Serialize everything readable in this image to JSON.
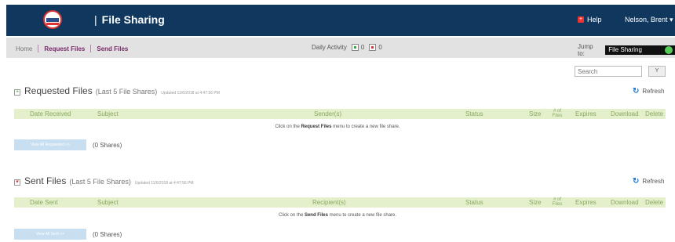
{
  "header": {
    "app_title": "File Sharing",
    "separator": "|",
    "help_label": "Help",
    "help_icon": "+",
    "user_name": "Nelson, Brent",
    "user_caret": "▾"
  },
  "nav": {
    "home": "Home",
    "request_files": "Request Files",
    "send_files": "Send Files"
  },
  "daily_activity": {
    "label": "Daily Activity",
    "up_count": "0",
    "down_count": "0"
  },
  "jump": {
    "label": "Jump to:",
    "selected": "File Sharing"
  },
  "search": {
    "placeholder": "Search",
    "button": "Y"
  },
  "requested": {
    "title": "Requested Files",
    "subtitle": "(Last 5 File Shares)",
    "updated": "Updated 11/6/2018 at 4:47:56 PM",
    "refresh_label": "Refresh",
    "columns": {
      "date": "Date Received",
      "subject": "Subject",
      "party": "Sender(s)",
      "status": "Status",
      "size": "Size",
      "files": "# of Files",
      "expires": "Expires",
      "download": "Download",
      "delete": "Delete"
    },
    "empty_pre": "Click on the",
    "empty_menu": "Request Files",
    "empty_post": "menu to create a new file share.",
    "view_all": "View All Requested >>",
    "shares": "(0 Shares)"
  },
  "sent": {
    "title": "Sent Files",
    "subtitle": "(Last 5 File Shares)",
    "updated": "Updated 11/6/2018 at 4:47:56 PM",
    "refresh_label": "Refresh",
    "columns": {
      "date": "Date Sent",
      "subject": "Subject",
      "party": "Recipient(s)",
      "status": "Status",
      "size": "Size",
      "files": "# of Files",
      "expires": "Expires",
      "download": "Download",
      "delete": "Delete"
    },
    "empty_pre": "Click on the",
    "empty_menu": "Send Files",
    "empty_post": "menu to create a new file share.",
    "view_all": "View All Sent >>",
    "shares": "(0 Shares)"
  },
  "colors": {
    "header_bg": "#10385f",
    "nav_link": "#7a2a6c",
    "table_head_bg": "#e3f0cb",
    "table_head_text": "#8aa860",
    "view_all_bg": "#c7dff0"
  }
}
